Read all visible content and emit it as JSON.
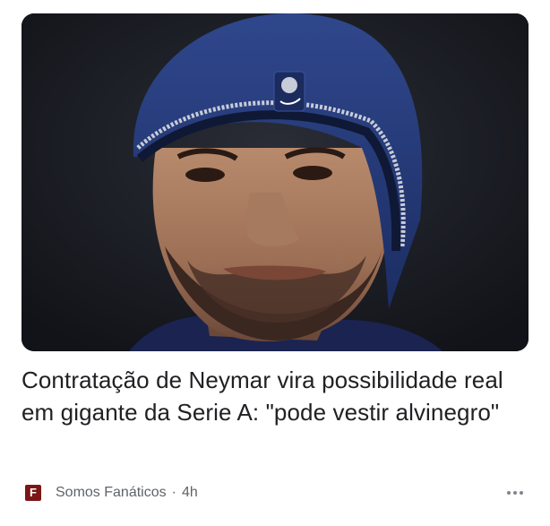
{
  "article": {
    "headline": "Contratação de Neymar vira possibilidade real em gigante da Serie A: \"pode vestir alvinegro\"",
    "source": {
      "name": "Somos Fanáticos",
      "logo_letter": "F",
      "logo_color": "#7a1616"
    },
    "separator": "·",
    "age": "4h",
    "more_icon": "more-horizontal-icon"
  },
  "colors": {
    "headline_text": "#202124",
    "meta_text": "#5f6368",
    "beanie": "#243a78"
  }
}
